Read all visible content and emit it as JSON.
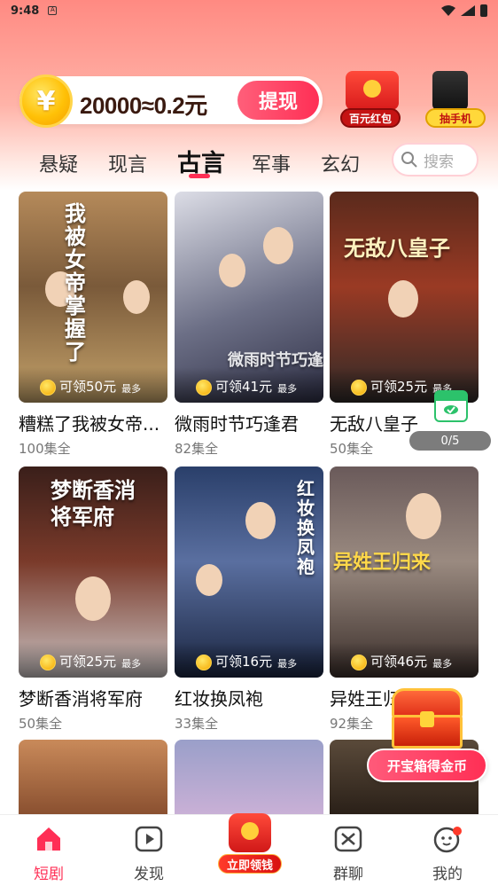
{
  "status_bar": {
    "time": "9:48",
    "notification_letter": "A"
  },
  "header": {
    "coin_symbol": "¥",
    "balance_text": "20000≈0.2元",
    "withdraw_label": "提现",
    "promo_redpack_label": "百元红包",
    "promo_phone_label": "抽手机"
  },
  "tabs": [
    {
      "label": "悬疑"
    },
    {
      "label": "现言"
    },
    {
      "label": "古言",
      "active": true
    },
    {
      "label": "军事"
    },
    {
      "label": "玄幻"
    }
  ],
  "search": {
    "placeholder": "搜索"
  },
  "cards": [
    {
      "title": "糟糕了我被女帝...",
      "episodes": "100集全",
      "reward": "可领50元",
      "more": "最多",
      "poster_text": "我被女帝掌握了"
    },
    {
      "title": "微雨时节巧逢君",
      "episodes": "82集全",
      "reward": "可领41元",
      "more": "最多",
      "poster_text": "微雨时节巧逢君"
    },
    {
      "title": "无敌八皇子",
      "episodes": "50集全",
      "reward": "可领25元",
      "more": "最多",
      "poster_text": "无敌八皇子"
    },
    {
      "title": "梦断香消将军府",
      "episodes": "50集全",
      "reward": "可领25元",
      "more": "最多",
      "poster_text": "梦断香消将军府"
    },
    {
      "title": "红妆换凤袍",
      "episodes": "33集全",
      "reward": "可领16元",
      "more": "最多",
      "poster_text": "红妆换凤袍"
    },
    {
      "title": "异姓王归来",
      "episodes": "92集全",
      "reward": "可领46元",
      "more": "最多",
      "poster_text": "异姓王归来"
    }
  ],
  "floating": {
    "progress": "0/5",
    "chest_button": "开宝箱得金币"
  },
  "bottom_nav": [
    {
      "label": "短剧",
      "active": true
    },
    {
      "label": "发现"
    },
    {
      "label": "立即领钱"
    },
    {
      "label": "群聊"
    },
    {
      "label": "我的"
    }
  ],
  "colors": {
    "accent": "#ff2f55",
    "gold": "#ffc107",
    "header_gradient_top": "#ff8a82"
  }
}
